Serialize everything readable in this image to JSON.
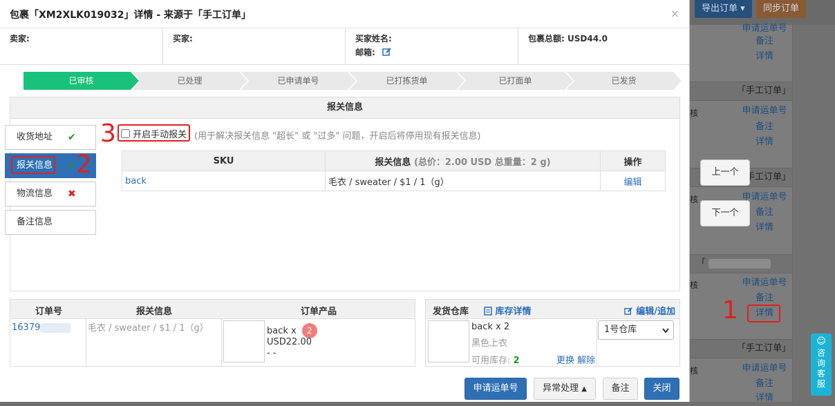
{
  "modal": {
    "title": "包裹「XM2XLK019032」详情 - 来源于「手工订单」",
    "close": "×",
    "seller_label": "卖家:",
    "buyer_label": "买家:",
    "buyer_name_label": "买家姓名:",
    "email_label": "邮箱:",
    "total_label": "包裹总额:",
    "total_value": "USD44.0"
  },
  "steps": [
    "已审核",
    "已处理",
    "已申请单号",
    "已打拣货单",
    "已打面单",
    "已发货"
  ],
  "active_step": 0,
  "panel": {
    "title": "报关信息",
    "sidebar": [
      {
        "label": "收货地址",
        "mark": "✔",
        "mark_color": "#1a9a1a"
      },
      {
        "label": "报关信息",
        "mark": "✔",
        "mark_color": "#1a9a1a"
      },
      {
        "label": "物流信息",
        "mark": "✖",
        "mark_color": "#e02020"
      },
      {
        "label": "备注信息",
        "mark": "",
        "mark_color": ""
      }
    ],
    "manual_checkbox_label": "开启手动报关",
    "hint": "(用于解决报关信息 \"超长\" 或 \"过多\" 问题，开启后将停用现有报关信息)",
    "table_headers": {
      "sku": "SKU",
      "info": "报关信息",
      "info_sub": "(总价：2.00 USD 总重量：2 g)",
      "op": "操作"
    },
    "rows": [
      {
        "sku": "back",
        "info": "毛衣 / sweater / $1 / 1（g）",
        "op": "编辑"
      }
    ]
  },
  "order_table": {
    "headers": [
      "订单号",
      "报关信息",
      "订单产品"
    ],
    "order_no": "16379",
    "declare": "毛衣 / sweater / $1 / 1（g）",
    "product_name": "back x",
    "product_badge": "2",
    "product_price": "USD22.00",
    "product_extra": "- -"
  },
  "warehouse": {
    "label": "发货仓库",
    "stock_detail": "库存详情",
    "edit_add": "编辑/追加",
    "item_name": "back x 2",
    "item_desc": "黑色上衣",
    "stock_label": "可用库存:",
    "stock_value": "2",
    "replace": "更换",
    "release": "解除",
    "selected_warehouse": "1号仓库"
  },
  "footer": {
    "apply": "申请运单号",
    "exception": "异常处理",
    "note": "备注",
    "close": "关闭"
  },
  "background": {
    "export_btn": "导出订单",
    "sync_btn": "同步订单",
    "apply_link": "申请运单号",
    "note_link": "备注",
    "detail_link": "详情",
    "manual_order": "「手工订单」",
    "core": "核",
    "prev": "上一个",
    "next": "下一个",
    "chat": "咨询客服"
  },
  "annotations": [
    "1",
    "2",
    "3"
  ],
  "colors": {
    "primary": "#2f6fb4",
    "step_active": "#19c27a",
    "step_inactive": "#e9e9e9",
    "annotation": "#e02020"
  }
}
